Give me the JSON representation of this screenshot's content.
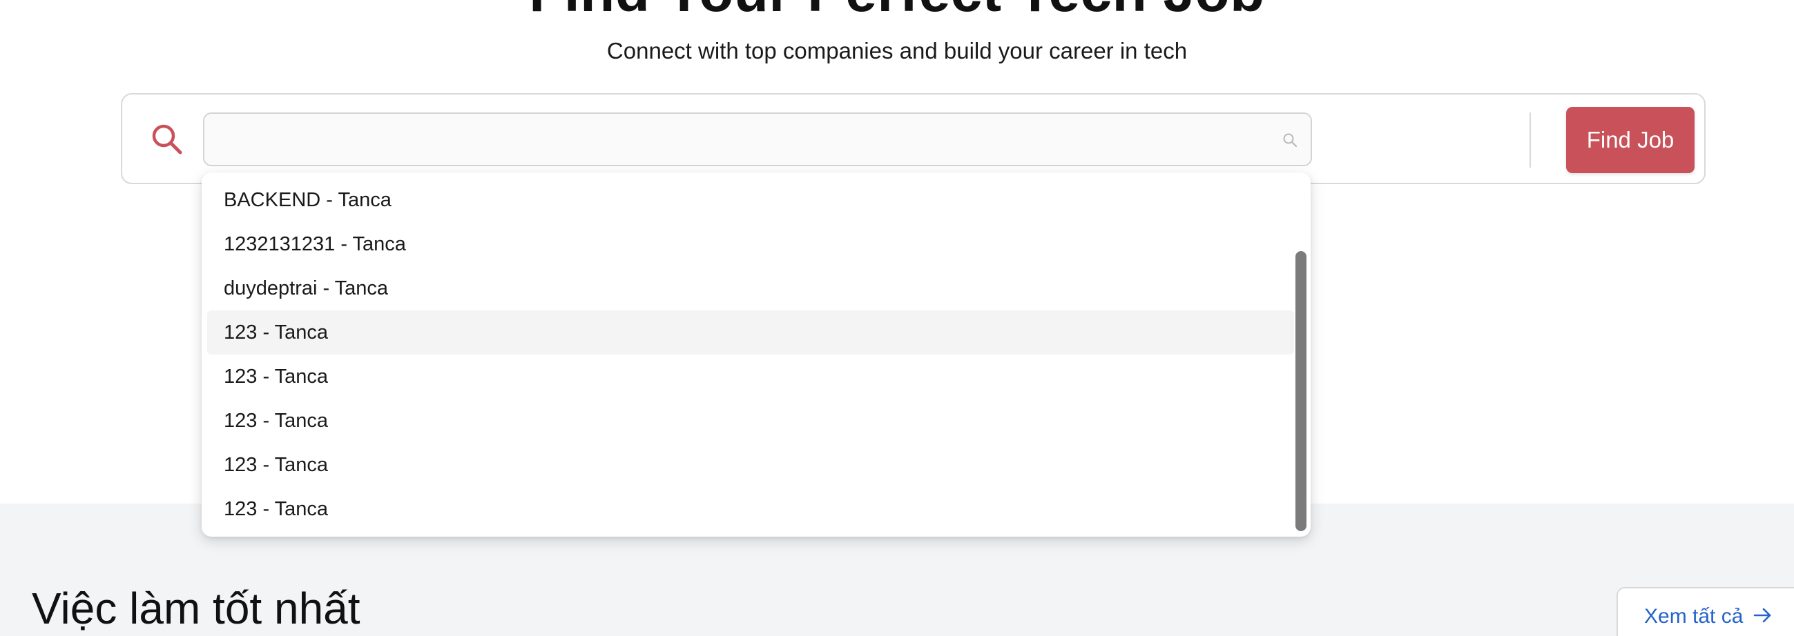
{
  "hero": {
    "title": "Find Your Perfect Tech Job",
    "subtitle": "Connect with top companies and build your career in tech"
  },
  "search": {
    "value": "",
    "placeholder": "",
    "lead_icon": "search-icon",
    "input_icon": "search-icon",
    "button_label": "Find Job",
    "accent_color": "#c9525a"
  },
  "dropdown": {
    "items": [
      "BACKEND - Tanca",
      "1232131231 - Tanca",
      "duydeptrai - Tanca",
      "123 - Tanca",
      "123 - Tanca",
      "123 - Tanca",
      "123 - Tanca",
      "123 - Tanca"
    ],
    "active_index": 3
  },
  "section": {
    "title": "Việc làm tốt nhất",
    "view_all_label": "Xem tất cả",
    "view_all_icon": "arrow-right-icon",
    "link_color": "#2563c9"
  }
}
